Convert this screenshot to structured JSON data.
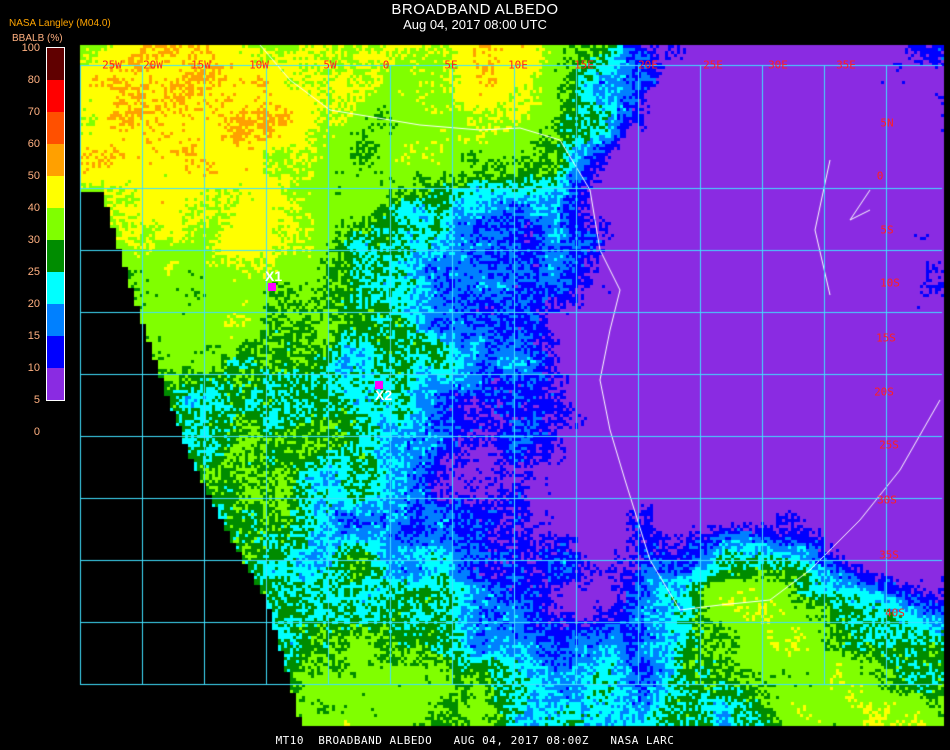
{
  "header": {
    "title": "BROADBAND ALBEDO",
    "subtitle": "Aug 04, 2017 08:00 UTC"
  },
  "legend": {
    "organization": "NASA Langley (M04.0)",
    "unit_label": "BBALB (%)",
    "ticks": [
      "100",
      "80",
      "70",
      "60",
      "50",
      "40",
      "30",
      "25",
      "20",
      "15",
      "10",
      "5",
      "0"
    ],
    "bins": [
      {
        "min": 80,
        "max": 100,
        "color": "#600000"
      },
      {
        "min": 70,
        "max": 80,
        "color": "#ff0000"
      },
      {
        "min": 60,
        "max": 70,
        "color": "#ff5000"
      },
      {
        "min": 50,
        "max": 60,
        "color": "#ffa000"
      },
      {
        "min": 40,
        "max": 50,
        "color": "#ffff00"
      },
      {
        "min": 30,
        "max": 40,
        "color": "#80ff00"
      },
      {
        "min": 25,
        "max": 30,
        "color": "#008c00"
      },
      {
        "min": 20,
        "max": 25,
        "color": "#00ffff"
      },
      {
        "min": 15,
        "max": 20,
        "color": "#0080ff"
      },
      {
        "min": 10,
        "max": 15,
        "color": "#0000ff"
      },
      {
        "min": 0,
        "max": 10,
        "color": "#8a2be2"
      }
    ]
  },
  "map": {
    "longitude_labels": [
      "25W",
      "20W",
      "15W",
      "10W",
      "5W",
      "0",
      "5E",
      "10E",
      "15E",
      "20E",
      "25E",
      "30E",
      "35E"
    ],
    "latitude_labels": [
      "5N",
      "0",
      "5S",
      "10S",
      "15S",
      "20S",
      "25S",
      "30S",
      "35S",
      "40S"
    ],
    "grid_color": "#40e0ff",
    "coastline_color": "#ffffff",
    "markers": [
      {
        "label": "X1",
        "color": "#ff00ff"
      },
      {
        "label": "X2",
        "color": "#ff00ff"
      }
    ]
  },
  "footer": {
    "text": "MT10  BROADBAND ALBEDO   AUG 04, 2017 08:00Z   NASA LARC"
  }
}
